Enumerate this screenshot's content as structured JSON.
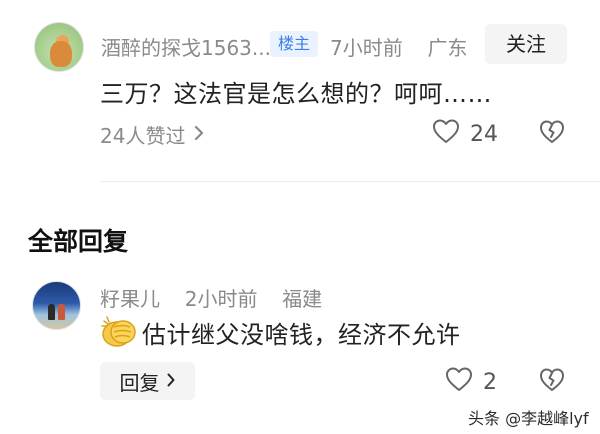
{
  "comment": {
    "author": "酒醉的探戈1563...",
    "badge": "楼主",
    "time": "7小时前",
    "location": "广东",
    "follow_label": "关注",
    "text": "三万？这法官是怎么想的？呵呵……",
    "likes_link": "24人赞过",
    "like_count": "24"
  },
  "section": {
    "title": "全部回复"
  },
  "reply": {
    "author": "籽果儿",
    "time": "2小时前",
    "location": "福建",
    "text": "估计继父没啥钱，经济不允许",
    "reply_label": "回复",
    "like_count": "2"
  },
  "watermark": "头条 @李越峰lyf",
  "icons": {
    "chevron": "chevron-right-icon",
    "like": "heart-outline-icon",
    "dislike": "broken-heart-icon",
    "clap": "clapping-hands-emoji"
  },
  "colors": {
    "badge_bg": "#eaf2ff",
    "badge_text": "#3d7ee6",
    "muted_text": "#8a8a8a",
    "button_bg": "#f4f4f4"
  }
}
